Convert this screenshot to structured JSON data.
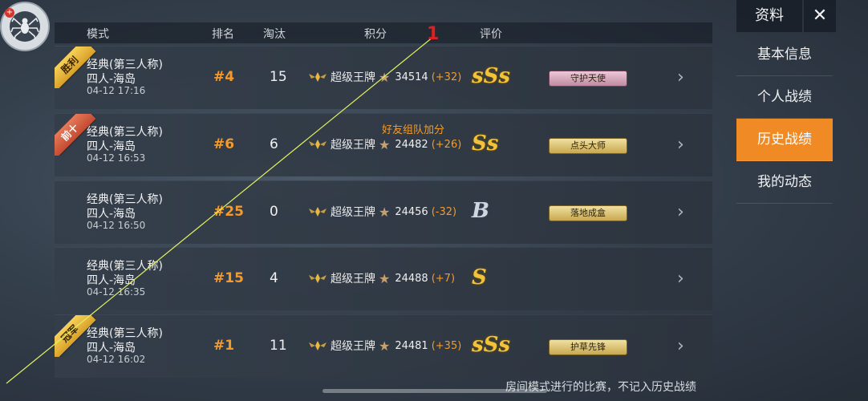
{
  "header": {
    "mode": "模式",
    "rank": "排名",
    "kills": "淘汰",
    "score": "积分",
    "rating": "评价"
  },
  "sidebar": {
    "title": "资料",
    "items": [
      {
        "label": "基本信息"
      },
      {
        "label": "个人战绩"
      },
      {
        "label": "历史战绩"
      },
      {
        "label": "我的动态"
      }
    ],
    "active_index": 2
  },
  "rows": [
    {
      "ribbon": "胜利",
      "mode_line1": "经典(第三人称)",
      "mode_line2": "四人-海岛",
      "date": "04-12 17:16",
      "rank": "#4",
      "kills": "15",
      "tier": "超级王牌",
      "score": "34514",
      "delta": "(+32)",
      "grade": "sSs",
      "badge": "守护天使",
      "bonus": ""
    },
    {
      "ribbon": "前十",
      "mode_line1": "经典(第三人称)",
      "mode_line2": "四人-海岛",
      "date": "04-12 16:53",
      "rank": "#6",
      "kills": "6",
      "tier": "超级王牌",
      "score": "24482",
      "delta": "(+26)",
      "grade": "Ss",
      "badge": "点头大师",
      "bonus": "好友组队加分"
    },
    {
      "ribbon": "",
      "mode_line1": "经典(第三人称)",
      "mode_line2": "四人-海岛",
      "date": "04-12 16:50",
      "rank": "#25",
      "kills": "0",
      "tier": "超级王牌",
      "score": "24456",
      "delta": "(-32)",
      "grade": "B",
      "badge": "落地成盒",
      "bonus": ""
    },
    {
      "ribbon": "",
      "mode_line1": "经典(第三人称)",
      "mode_line2": "四人-海岛",
      "date": "04-12 16:35",
      "rank": "#15",
      "kills": "4",
      "tier": "超级王牌",
      "score": "24488",
      "delta": "(+7)",
      "grade": "S",
      "badge": "",
      "bonus": ""
    },
    {
      "ribbon": "冠军",
      "mode_line1": "经典(第三人称)",
      "mode_line2": "四人-海岛",
      "date": "04-12 16:02",
      "rank": "#1",
      "kills": "11",
      "tier": "超级王牌",
      "score": "24481",
      "delta": "(+35)",
      "grade": "sSs",
      "badge": "护草先锋",
      "bonus": ""
    }
  ],
  "footer_note": "房间模式进行的比赛，不记入历史战绩",
  "annotation_mark": "1",
  "colors": {
    "accent": "#f08a24",
    "rank": "#f39a2a",
    "grade_gold": "#f2c33a"
  },
  "icons": {
    "avatar": "spider-icon",
    "close": "close-icon",
    "row_chevron": "chevron-right-icon",
    "tier": "ace-wings-icon",
    "star": "star-icon"
  }
}
